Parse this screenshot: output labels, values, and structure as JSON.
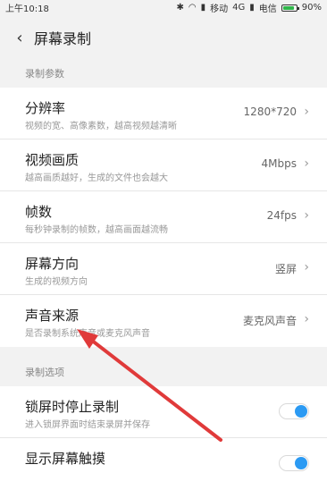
{
  "status": {
    "time": "上午10:18",
    "carrier1": "移动",
    "network": "4G",
    "carrier2": "电信",
    "battery_percent": 90,
    "battery_label": "90%"
  },
  "header": {
    "back_icon": "chevron-left-icon",
    "title": "屏幕录制"
  },
  "section1": {
    "label": "录制参数",
    "rows": [
      {
        "title": "分辨率",
        "subtitle": "视频的宽、高像素数，越高视频越清晰",
        "value": "1280*720"
      },
      {
        "title": "视频画质",
        "subtitle": "越高画质越好，生成的文件也会越大",
        "value": "4Mbps"
      },
      {
        "title": "帧数",
        "subtitle": "每秒钟录制的帧数，越高画面越流畅",
        "value": "24fps"
      },
      {
        "title": "屏幕方向",
        "subtitle": "生成的视频方向",
        "value": "竖屏"
      },
      {
        "title": "声音来源",
        "subtitle": "是否录制系统声音或麦克风声音",
        "value": "麦克风声音"
      }
    ]
  },
  "section2": {
    "label": "录制选项",
    "rows": [
      {
        "title": "锁屏时停止录制",
        "subtitle": "进入锁屏界面时结束录屏并保存",
        "toggle_on": true
      },
      {
        "title": "显示屏幕触摸",
        "subtitle": "",
        "toggle_on": true
      }
    ]
  },
  "colors": {
    "accent": "#2b9af3",
    "annotation_arrow": "#e03a3a",
    "battery": "#2fb64a"
  }
}
